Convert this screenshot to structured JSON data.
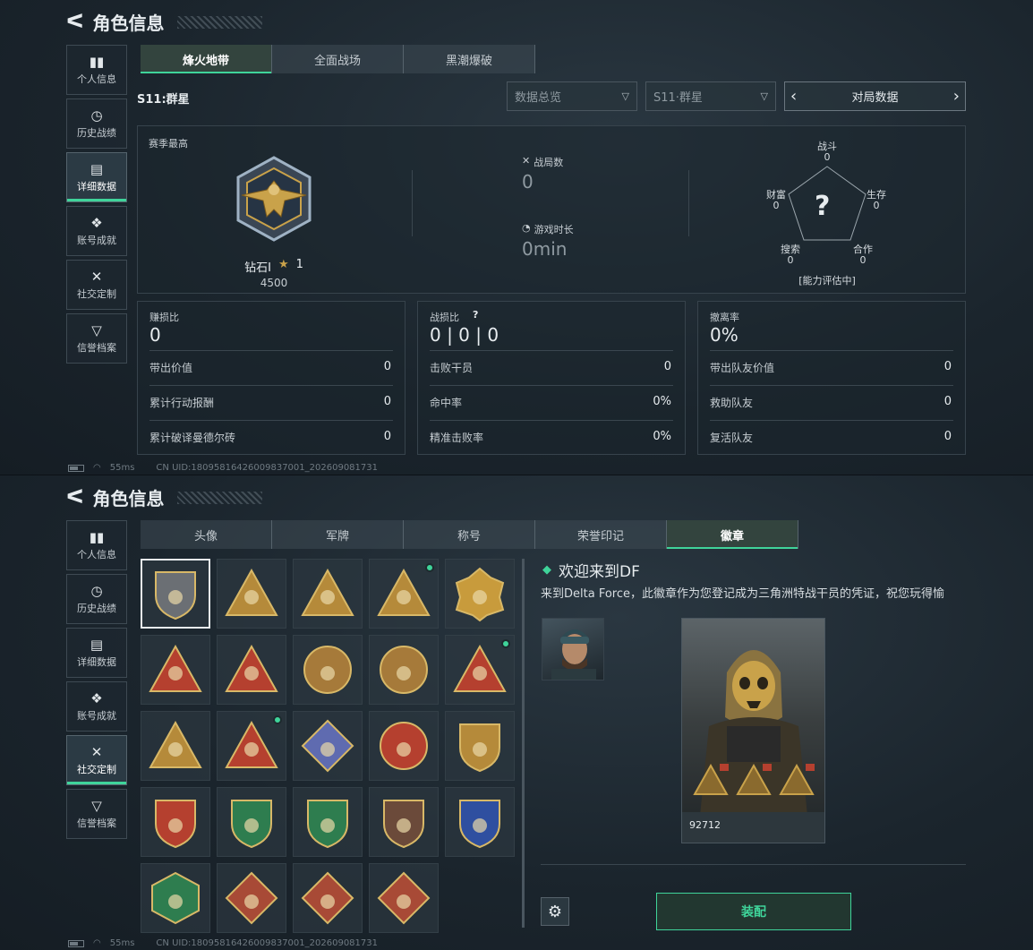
{
  "common": {
    "title": "角色信息",
    "back_glyph": "ᐸ",
    "status": {
      "ping": "55ms",
      "uid": "CN UID:18095816426009837001_202609081731"
    },
    "sidebar": [
      {
        "icon": "bar-chart-icon",
        "glyph": "▮▮",
        "label": "个人信息"
      },
      {
        "icon": "history-icon",
        "glyph": "◷",
        "label": "历史战绩"
      },
      {
        "icon": "folder-icon",
        "glyph": "▤",
        "label": "详细数据"
      },
      {
        "icon": "achievement-icon",
        "glyph": "❖",
        "label": "账号成就"
      },
      {
        "icon": "tools-icon",
        "glyph": "✕",
        "label": "社交定制"
      },
      {
        "icon": "honor-icon",
        "glyph": "▽",
        "label": "信誉档案"
      }
    ]
  },
  "panel1": {
    "active_sidebar": "详细数据",
    "tabs": [
      "烽火地带",
      "全面战场",
      "黑潮爆破"
    ],
    "active_tab": "烽火地带",
    "season_label": "S11:群星",
    "filter1": "数据总览",
    "filter2": "S11·群星",
    "nav_label": "对局数据",
    "season_best": "赛季最高",
    "rank_name": "钻石I",
    "rank_stars": "1",
    "rank_points": "4500",
    "matches_label": "战局数",
    "matches_value": "0",
    "time_label": "游戏时长",
    "time_value": "0min",
    "radar": {
      "question": "?",
      "axes": [
        {
          "label": "战斗",
          "value": "0"
        },
        {
          "label": "生存",
          "value": "0"
        },
        {
          "label": "合作",
          "value": "0"
        },
        {
          "label": "搜索",
          "value": "0"
        },
        {
          "label": "财富",
          "value": "0"
        }
      ],
      "note": "[能力评估中]"
    },
    "cards": [
      {
        "head_label": "赚损比",
        "head_value": "0",
        "rows": [
          [
            "带出价值",
            "0"
          ],
          [
            "累计行动报酬",
            "0"
          ],
          [
            "累计破译曼德尔砖",
            "0"
          ]
        ]
      },
      {
        "head_label": "战损比",
        "head_value": "0 | 0 | 0",
        "rows": [
          [
            "击败干员",
            "0"
          ],
          [
            "命中率",
            "0%"
          ],
          [
            "精准击败率",
            "0%"
          ]
        ]
      },
      {
        "head_label": "撤离率",
        "head_value": "0%",
        "rows": [
          [
            "带出队友价值",
            "0"
          ],
          [
            "救助队友",
            "0"
          ],
          [
            "复活队友",
            "0"
          ]
        ]
      }
    ]
  },
  "panel2": {
    "active_sidebar": "社交定制",
    "tabs": [
      "头像",
      "军牌",
      "称号",
      "荣誉印记",
      "徽章"
    ],
    "active_tab": "徽章",
    "badges": [
      {
        "name": "badge-delta-logo",
        "color": "#6b6f74",
        "shape": "shield",
        "new": false
      },
      {
        "name": "badge-helicopter",
        "color": "#b58a3a",
        "shape": "triangle",
        "new": false
      },
      {
        "name": "badge-s8",
        "color": "#b58a3a",
        "shape": "triangle",
        "new": false
      },
      {
        "name": "badge-s9",
        "color": "#b58a3a",
        "shape": "triangle",
        "new": true
      },
      {
        "name": "badge-s10",
        "color": "#c89b3c",
        "shape": "gear",
        "new": false
      },
      {
        "name": "badge-wings",
        "color": "#b5402f",
        "shape": "triangle",
        "new": false
      },
      {
        "name": "badge-one",
        "color": "#b5402f",
        "shape": "triangle",
        "new": false
      },
      {
        "name": "badge-delta-force-seal",
        "color": "#a67a3a",
        "shape": "circle",
        "new": false
      },
      {
        "name": "badge-delta-force-2026",
        "color": "#a67a3a",
        "shape": "circle",
        "new": false
      },
      {
        "name": "badge-tower",
        "color": "#b5402f",
        "shape": "triangle",
        "new": true
      },
      {
        "name": "badge-squad",
        "color": "#b58a3a",
        "shape": "triangle",
        "new": false
      },
      {
        "name": "badge-rocket",
        "color": "#b5402f",
        "shape": "triangle",
        "new": true
      },
      {
        "name": "badge-rose",
        "color": "#5f6bb0",
        "shape": "diamond",
        "new": false
      },
      {
        "name": "badge-star",
        "color": "#b5402f",
        "shape": "circle",
        "new": false
      },
      {
        "name": "badge-chevron",
        "color": "#b58a3a",
        "shape": "shield",
        "new": false
      },
      {
        "name": "badge-blue-shield",
        "color": "#b5402f",
        "shape": "shield",
        "new": false
      },
      {
        "name": "badge-green-gem",
        "color": "#2e7d4f",
        "shape": "shield",
        "new": false
      },
      {
        "name": "badge-green-crosshair",
        "color": "#2e7d4f",
        "shape": "shield",
        "new": false
      },
      {
        "name": "badge-rifle",
        "color": "#6b4a3a",
        "shape": "shield",
        "new": false
      },
      {
        "name": "badge-blue-crossed-rifles",
        "color": "#2f4fa0",
        "shape": "shield",
        "new": false
      },
      {
        "name": "badge-green-beast",
        "color": "#2e7d4f",
        "shape": "hex",
        "new": false
      },
      {
        "name": "badge-dragon-red",
        "color": "#a84a36",
        "shape": "diamond",
        "new": false
      },
      {
        "name": "badge-dragon-copper",
        "color": "#a84a36",
        "shape": "diamond",
        "new": false
      },
      {
        "name": "badge-runner",
        "color": "#a84a36",
        "shape": "diamond",
        "new": false
      }
    ],
    "detail_title": "欢迎来到DF",
    "detail_desc": "来到Delta Force，此徽章作为您登记成为三角洲特战干员的凭证，祝您玩得愉",
    "card_id": "92712",
    "equip_label": "装配"
  }
}
